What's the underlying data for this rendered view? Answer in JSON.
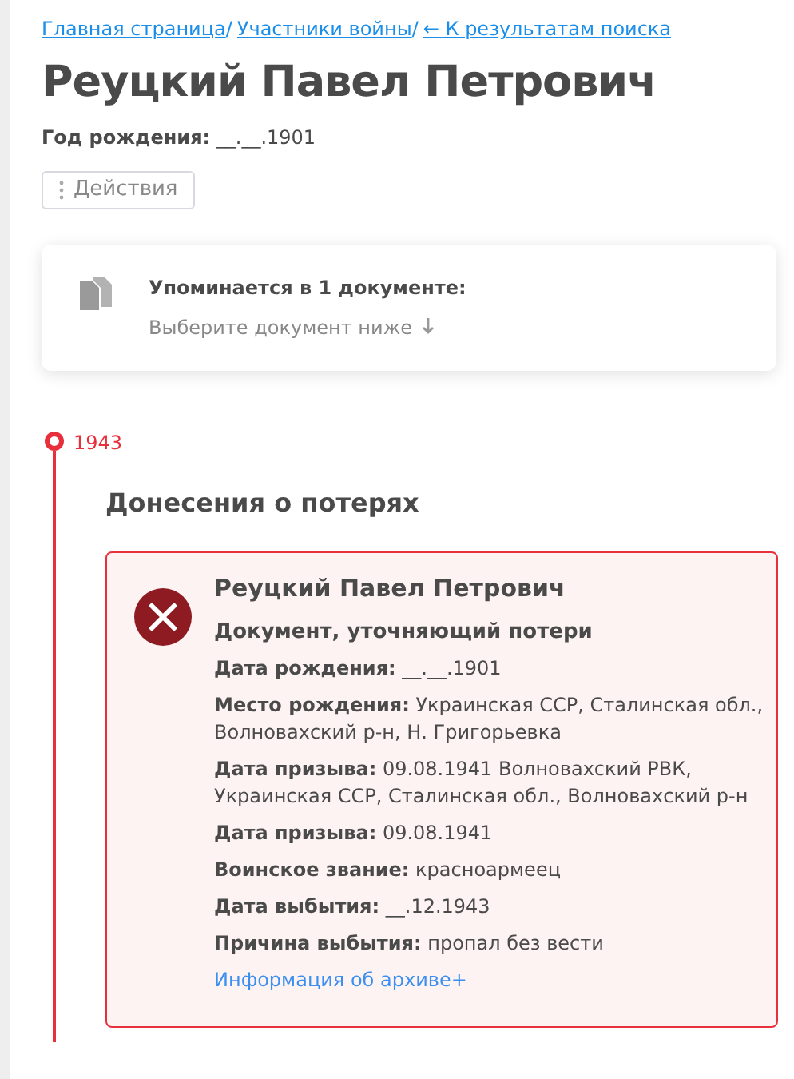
{
  "breadcrumbs": [
    {
      "label": "Главная страница",
      "separator": "/"
    },
    {
      "label": "Участники войны",
      "separator": "/"
    },
    {
      "label": "← К результатам поиска"
    }
  ],
  "title": "Реуцкий Павел Петрович",
  "birth_year": "**Год рождения:** __.__.1901",
  "actions_button": "Действия",
  "mentions": {
    "title": "Упоминается в 1 документе:",
    "hint": "Выберите документ ниже"
  },
  "timeline": [
    {
      "year": "1943",
      "section": "Донесения о потерях",
      "documents": [
        {
          "kind": "lost",
          "name": "Реуцкий Павел Петрович",
          "type": "Документ, уточняющий потери",
          "fields": [
            "**Дата рождения:** __.__.1901",
            "**Место рождения:** Украинская ССР, Сталинская обл., Волновахский р-н, Н. Григорьевка",
            "**Дата призыва:** 09.08.1941 Волновахский РВК, Украинская ССР, Сталинская обл., Волновахский р-н",
            "**Дата призыва:** 09.08.1941",
            "**Воинское звание:** красноармеец",
            "**Дата выбытия:** __.12.1943",
            "**Причина выбытия:** пропал без вести"
          ],
          "archive_link": "Информация об архиве+"
        }
      ]
    }
  ]
}
